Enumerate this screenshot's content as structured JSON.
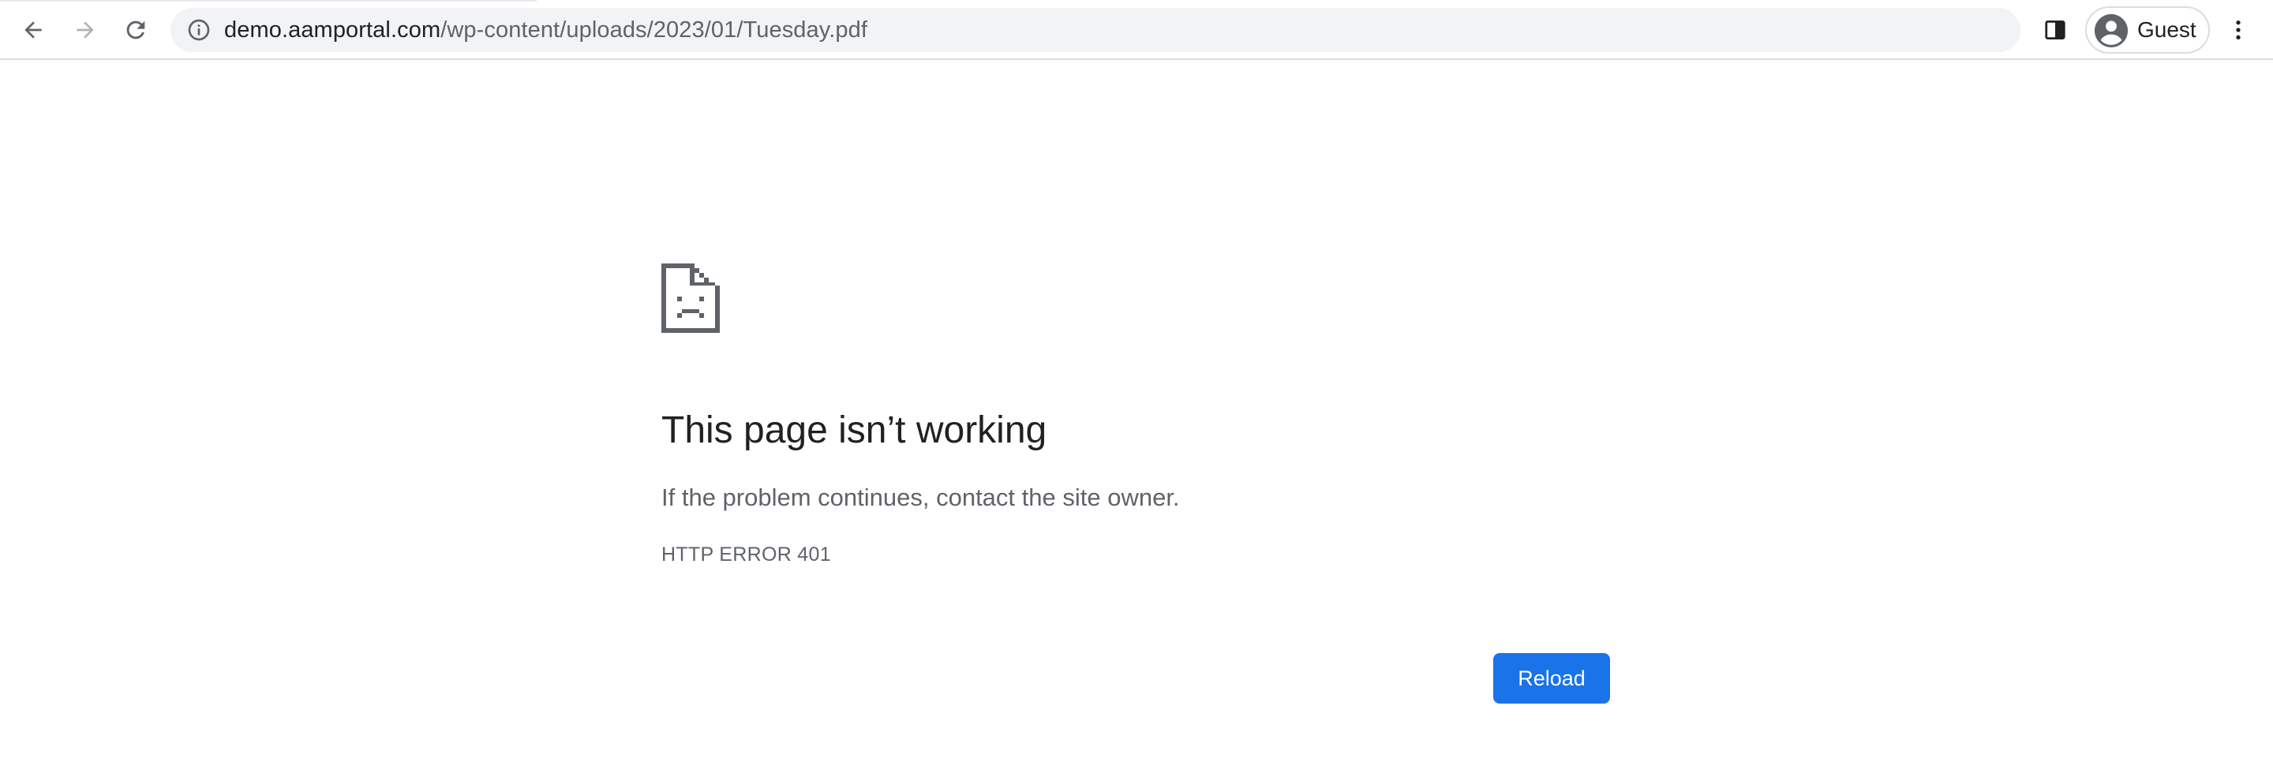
{
  "browser": {
    "nav": {
      "back_icon": "arrow-left-icon",
      "forward_icon": "arrow-right-icon",
      "reload_icon": "refresh-icon"
    },
    "omnibox": {
      "security_icon": "info-icon",
      "url_host": "demo.aamportal.com",
      "url_path": "/wp-content/uploads/2023/01/Tuesday.pdf"
    },
    "side_panel_icon": "side-panel-icon",
    "profile": {
      "avatar_icon": "account-circle-icon",
      "label": "Guest"
    },
    "menu_icon": "more-vert-icon"
  },
  "error_page": {
    "icon": "sad-page-icon",
    "title": "This page isn’t working",
    "description": "If the problem continues, contact the site owner.",
    "error_code": "HTTP ERROR 401",
    "reload_label": "Reload"
  },
  "colors": {
    "accent": "#1a73e8",
    "text_primary": "#202124",
    "text_secondary": "#5f6368",
    "omnibox_bg": "#f1f3f4"
  }
}
